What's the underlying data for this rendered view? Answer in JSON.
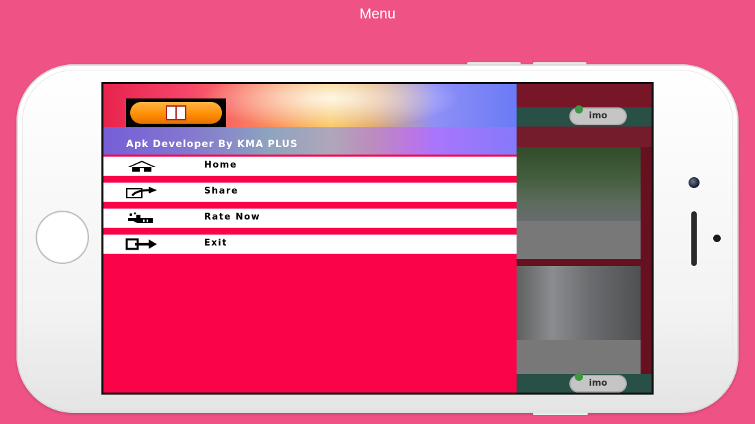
{
  "page": {
    "title": "Menu"
  },
  "drawer": {
    "subtitle": "Apk Developer By KMA PLUS",
    "items": [
      {
        "label": "Home",
        "icon": "home-icon"
      },
      {
        "label": "Share",
        "icon": "share-icon"
      },
      {
        "label": "Rate Now",
        "icon": "rate-hand-icon"
      },
      {
        "label": "Exit",
        "icon": "exit-icon"
      }
    ]
  },
  "background_app": {
    "ads": [
      {
        "label": "imo"
      },
      {
        "label": "imo"
      }
    ]
  },
  "colors": {
    "page_background": "#ef5285",
    "drawer_background": "#fb0349",
    "menu_item_background": "#ffffff"
  }
}
